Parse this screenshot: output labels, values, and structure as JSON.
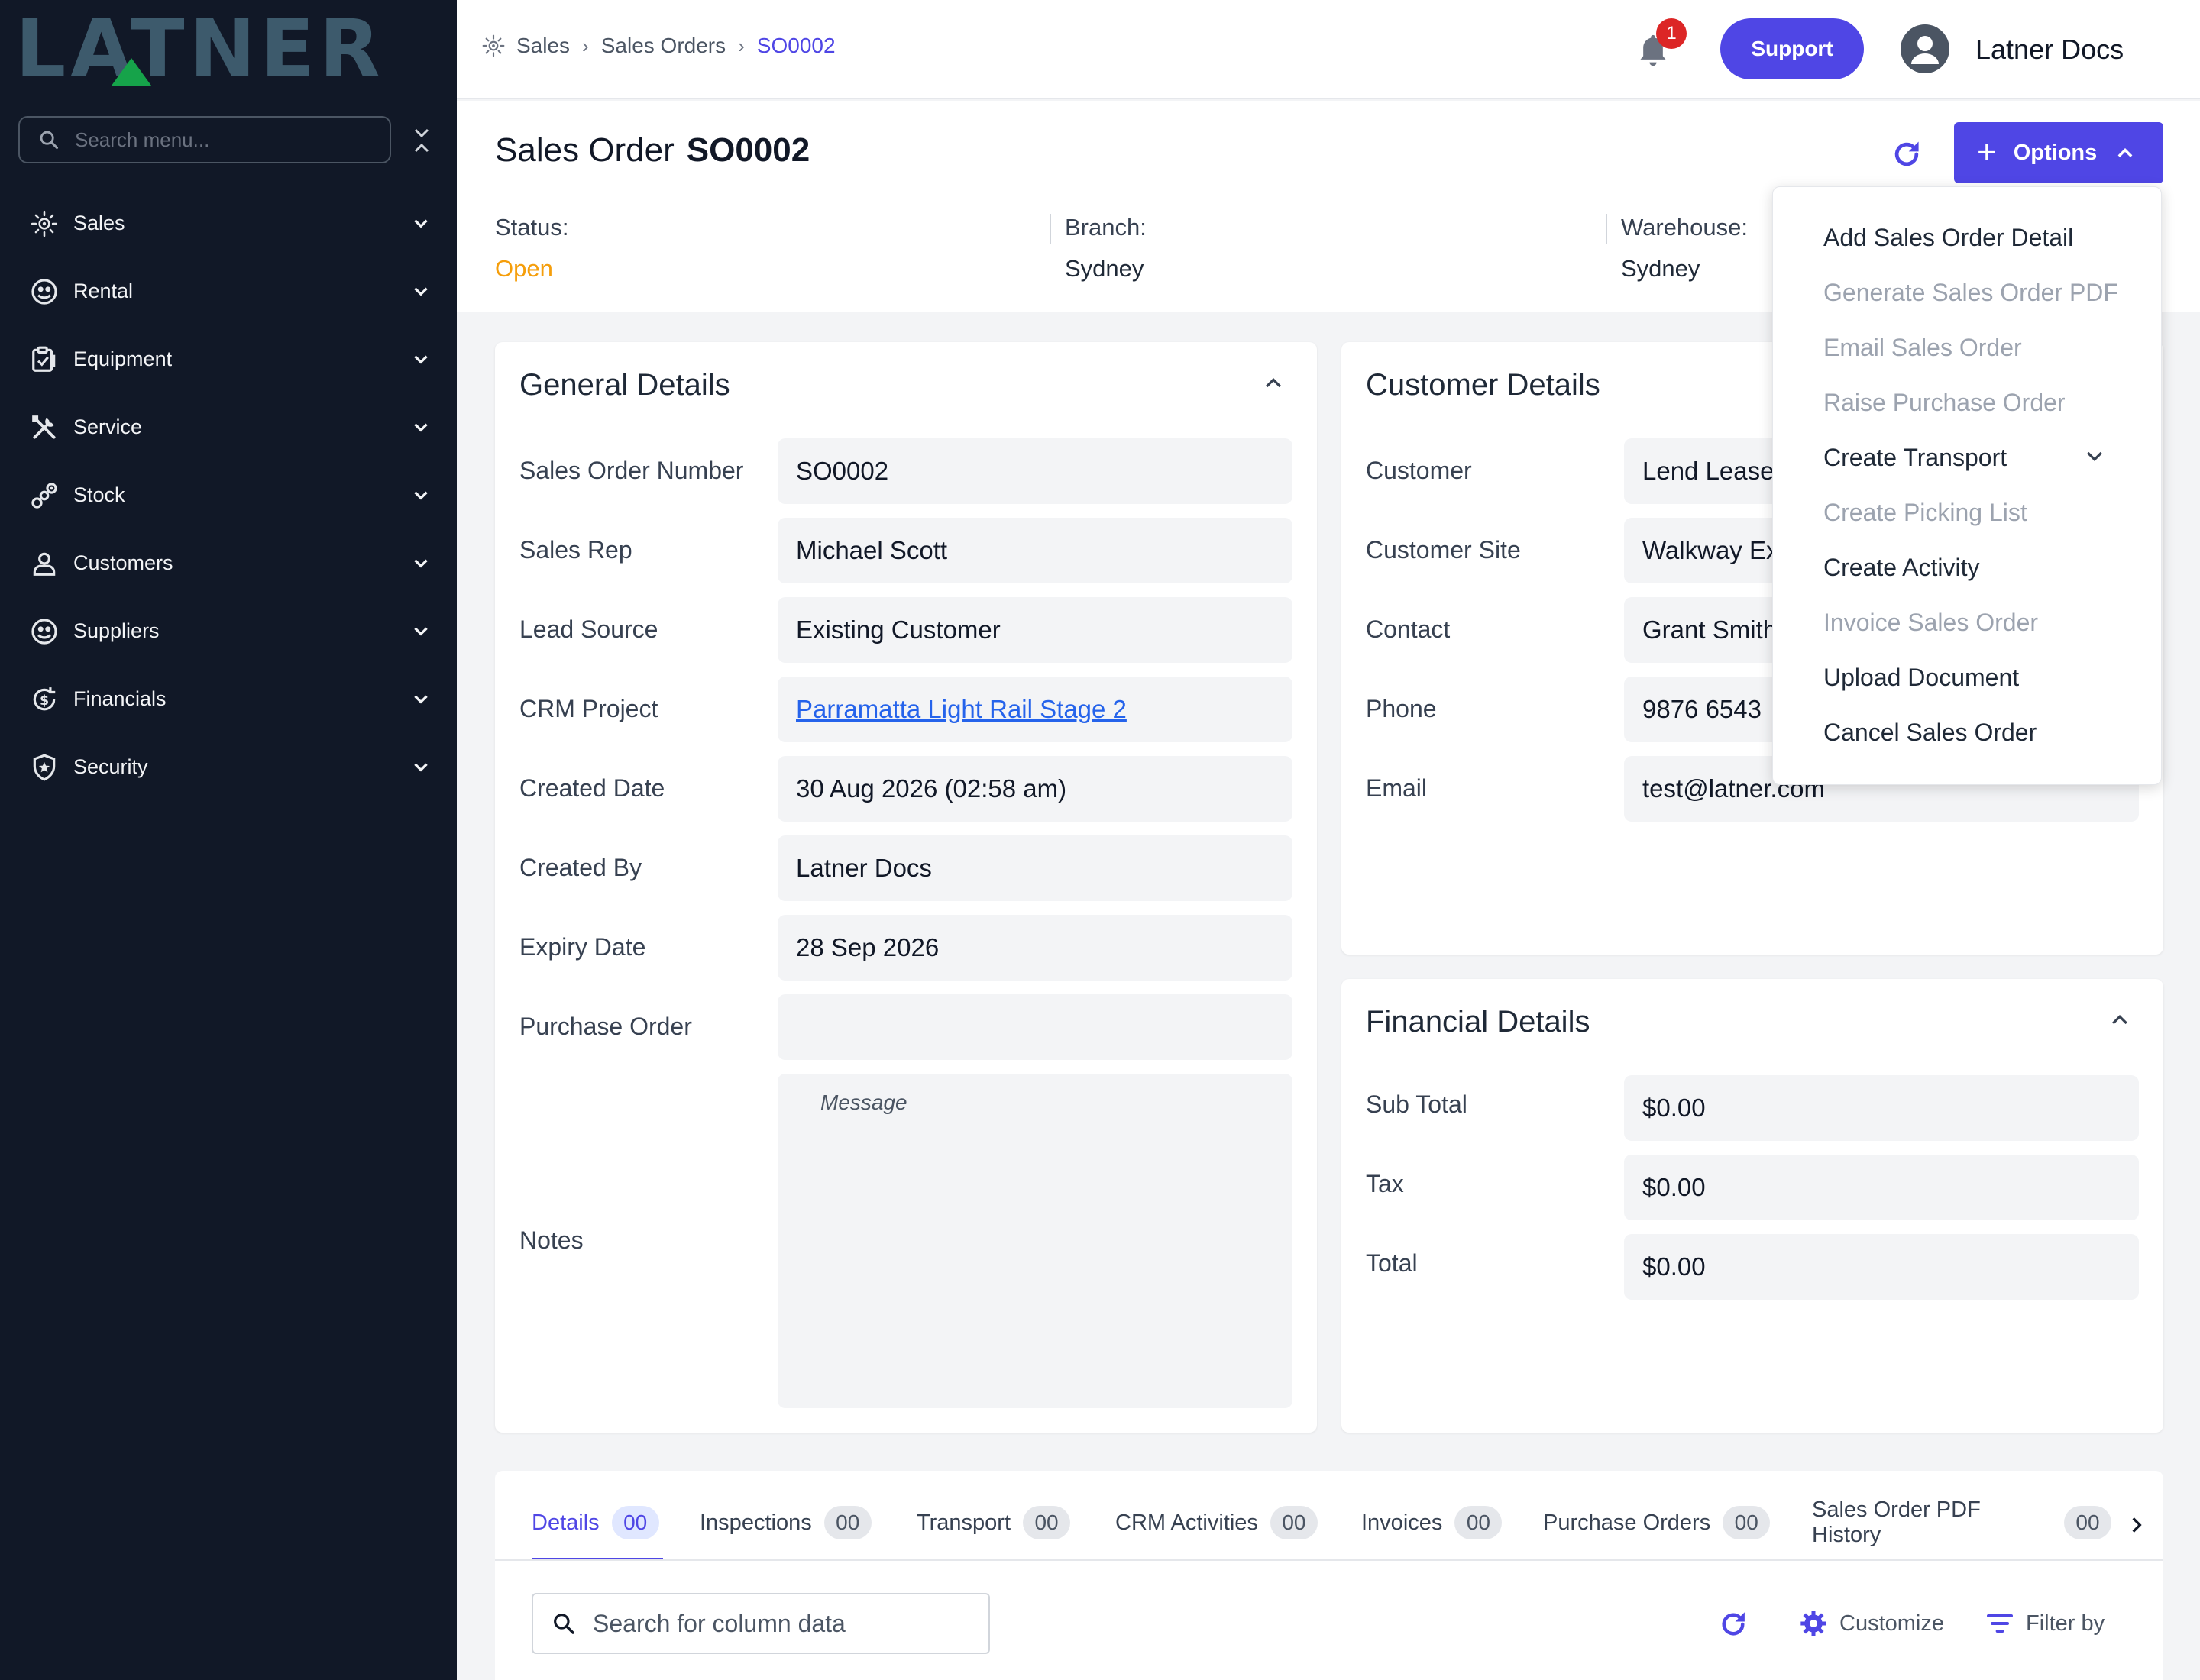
{
  "brand": {
    "logo_text": "LATNER",
    "accent": "#4f46e5"
  },
  "sidebar": {
    "search_placeholder": "Search menu...",
    "items": [
      {
        "label": "Sales",
        "icon": "sales-icon"
      },
      {
        "label": "Rental",
        "icon": "rental-icon"
      },
      {
        "label": "Equipment",
        "icon": "equipment-icon"
      },
      {
        "label": "Service",
        "icon": "service-icon"
      },
      {
        "label": "Stock",
        "icon": "stock-icon"
      },
      {
        "label": "Customers",
        "icon": "customers-icon"
      },
      {
        "label": "Suppliers",
        "icon": "suppliers-icon"
      },
      {
        "label": "Financials",
        "icon": "financials-icon"
      },
      {
        "label": "Security",
        "icon": "security-icon"
      }
    ]
  },
  "topbar": {
    "breadcrumbs": [
      "Sales",
      "Sales Orders",
      "SO0002"
    ],
    "notification_count": "1",
    "support_label": "Support",
    "user_name": "Latner Docs"
  },
  "header": {
    "title_prefix": "Sales Order",
    "title_code": "SO0002",
    "options_label": "Options",
    "status_label": "Status:",
    "status_value": "Open",
    "branch_label": "Branch:",
    "branch_value": "Sydney",
    "warehouse_label": "Warehouse:",
    "warehouse_value": "Sydney"
  },
  "options_menu": [
    {
      "label": "Add Sales Order Detail",
      "enabled": true
    },
    {
      "label": "Generate Sales Order PDF",
      "enabled": false
    },
    {
      "label": "Email Sales Order",
      "enabled": false
    },
    {
      "label": "Raise Purchase Order",
      "enabled": false
    },
    {
      "label": "Create Transport",
      "enabled": true
    },
    {
      "label": "Create Picking List",
      "enabled": false
    },
    {
      "label": "Create Activity",
      "enabled": true
    },
    {
      "label": "Invoice Sales Order",
      "enabled": false
    },
    {
      "label": "Upload Document",
      "enabled": true
    },
    {
      "label": "Cancel Sales Order",
      "enabled": true
    }
  ],
  "general": {
    "title": "General Details",
    "rows": [
      {
        "label": "Sales Order Number",
        "value": "SO0002"
      },
      {
        "label": "Sales Rep",
        "value": "Michael Scott"
      },
      {
        "label": "Lead Source",
        "value": "Existing Customer"
      },
      {
        "label": "CRM Project",
        "value": "Parramatta Light Rail Stage 2"
      },
      {
        "label": "Created Date",
        "value": "30 Aug 2026 (02:58 am)"
      },
      {
        "label": "Created By",
        "value": "Latner Docs"
      },
      {
        "label": "Expiry Date",
        "value": "28 Sep 2026"
      },
      {
        "label": "Purchase Order",
        "value": ""
      }
    ],
    "notes_label": "Notes",
    "notes_placeholder": "Message"
  },
  "customer": {
    "title": "Customer Details",
    "rows": [
      {
        "label": "Customer",
        "value": "Lend Lease"
      },
      {
        "label": "Customer Site",
        "value": "Walkway Ex"
      },
      {
        "label": "Contact",
        "value": "Grant Smith"
      },
      {
        "label": "Phone",
        "value": "9876 6543"
      },
      {
        "label": "Email",
        "value": "test@latner.com"
      }
    ]
  },
  "financial": {
    "title": "Financial Details",
    "rows": [
      {
        "label": "Sub Total",
        "value": "$0.00"
      },
      {
        "label": "Tax",
        "value": "$0.00"
      },
      {
        "label": "Total",
        "value": "$0.00"
      }
    ]
  },
  "tabs": [
    {
      "label": "Details",
      "count": "00"
    },
    {
      "label": "Inspections",
      "count": "00"
    },
    {
      "label": "Transport",
      "count": "00"
    },
    {
      "label": "CRM Activities",
      "count": "00"
    },
    {
      "label": "Invoices",
      "count": "00"
    },
    {
      "label": "Purchase Orders",
      "count": "00"
    },
    {
      "label": "Sales Order PDF History",
      "count": "00"
    }
  ],
  "grid": {
    "search_placeholder": "Search for column data",
    "customize_label": "Customize",
    "filter_label": "Filter by"
  }
}
